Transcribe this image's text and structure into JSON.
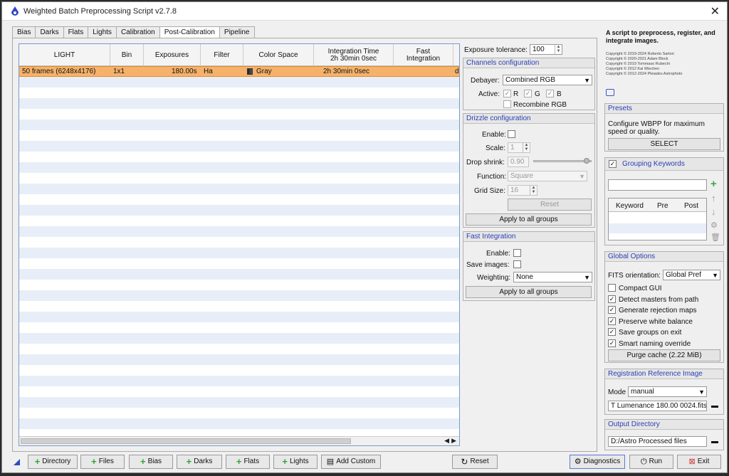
{
  "window": {
    "title": "Weighted Batch Preprocessing Script v2.7.8",
    "close_glyph": "✕"
  },
  "tabs": [
    "Bias",
    "Darks",
    "Flats",
    "Lights",
    "Calibration",
    "Post-Calibration",
    "Pipeline"
  ],
  "table": {
    "headers": [
      "LIGHT",
      "Bin",
      "Exposures",
      "Filter",
      "Color Space",
      "Integration Time\n2h 30min  0sec",
      "Fast\nIntegration"
    ],
    "rows": [
      {
        "light": "50 frames (6248x4176)",
        "bin": "1x1",
        "exposures": "180.00s",
        "filter": "Ha",
        "color_space": "Gray",
        "integration": "2h 30min   0sec",
        "fast": "d"
      }
    ]
  },
  "exposure_tolerance": {
    "label": "Exposure tolerance:",
    "value": "100"
  },
  "channels": {
    "title": "Channels configuration",
    "debayer_label": "Debayer:",
    "debayer_value": "Combined RGB",
    "active_label": "Active:",
    "r": "R",
    "g": "G",
    "b": "B",
    "check": "✓",
    "recombine_label": "Recombine RGB"
  },
  "drizzle": {
    "title": "Drizzle configuration",
    "enable_label": "Enable:",
    "scale_label": "Scale:",
    "scale_value": "1",
    "drop_label": "Drop shrink:",
    "drop_value": "0.90",
    "drop_level": 0.95,
    "function_label": "Function:",
    "function_value": "Square",
    "grid_label": "Grid Size:",
    "grid_value": "16",
    "reset_label": "Reset",
    "apply_label": "Apply to all groups"
  },
  "fast_integration": {
    "title": "Fast Integration",
    "enable_label": "Enable:",
    "save_label": "Save images:",
    "weighting_label": "Weighting:",
    "weighting_value": "None",
    "apply_label": "Apply to all groups"
  },
  "right": {
    "description": "A script to preprocess, register, and integrate images.",
    "credits": [
      "Copyright © 2019-2024 Roberto Sartori",
      "Copyright © 2020-2021 Adam Block",
      "Copyright © 2019 Tommaso Rubechi",
      "Copyright © 2012 Kai Wiechen",
      "Copyright © 2012-2024 Pleiades Astrophoto"
    ],
    "presets": {
      "title": "Presets",
      "text": "Configure WBPP for maximum speed or quality.",
      "select_label": "SELECT"
    },
    "grouping": {
      "title": "Grouping Keywords",
      "check": "✓",
      "cols": [
        "Keyword",
        "Pre",
        "Post"
      ]
    },
    "global": {
      "title": "Global Options",
      "fits_label": "FITS orientation:",
      "fits_value": "Global Pref",
      "options": [
        {
          "label": "Compact GUI",
          "checked": ""
        },
        {
          "label": "Detect masters from path",
          "checked": "✓"
        },
        {
          "label": "Generate rejection maps",
          "checked": "✓"
        },
        {
          "label": "Preserve white balance",
          "checked": "✓"
        },
        {
          "label": "Save groups on exit",
          "checked": "✓"
        },
        {
          "label": "Smart naming override",
          "checked": "✓"
        }
      ],
      "purge_label": "Purge cache (2.22 MiB)"
    },
    "registration": {
      "title": "Registration Reference Image",
      "mode_label": "Mode",
      "mode_value": "manual",
      "file_value": "T Lumenance 180.00 0024.fits"
    },
    "output": {
      "title": "Output Directory",
      "path": "D:/Astro Processed files"
    }
  },
  "bottom": {
    "directory": "Directory",
    "files": "Files",
    "bias": "Bias",
    "darks": "Darks",
    "flats": "Flats",
    "lights": "Lights",
    "add_custom": "Add Custom",
    "reset": "Reset",
    "diagnostics": "Diagnostics",
    "run": "Run",
    "exit": "Exit",
    "plus": "+"
  },
  "colors": {
    "accent_blue": "#2a3fb4",
    "selected_row": "#f6b26b",
    "plus_green": "#34a53f"
  }
}
